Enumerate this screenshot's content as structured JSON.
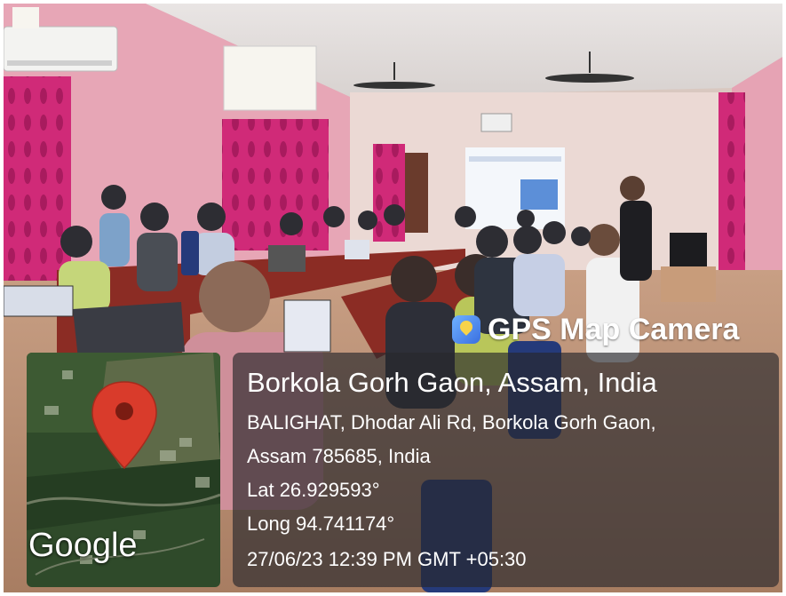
{
  "overlay": {
    "app_name": "GPS Map Camera",
    "place_title": "Borkola Gorh Gaon, Assam, India",
    "address_line_1": "BALIGHAT, Dhodar Ali Rd, Borkola Gorh Gaon,",
    "address_line_2": "Assam 785685, India",
    "latitude": "Lat 26.929593°",
    "longitude": "Long 94.741174°",
    "datetime": "27/06/23 12:39 PM GMT +05:30"
  },
  "map": {
    "attribution": "Google",
    "pin_color": "#d93b2b",
    "pin_icon": "map-pin-icon"
  },
  "colors": {
    "wall": "#e6a9b8",
    "curtain": "#d0307a",
    "panel": "#2c2c30"
  }
}
